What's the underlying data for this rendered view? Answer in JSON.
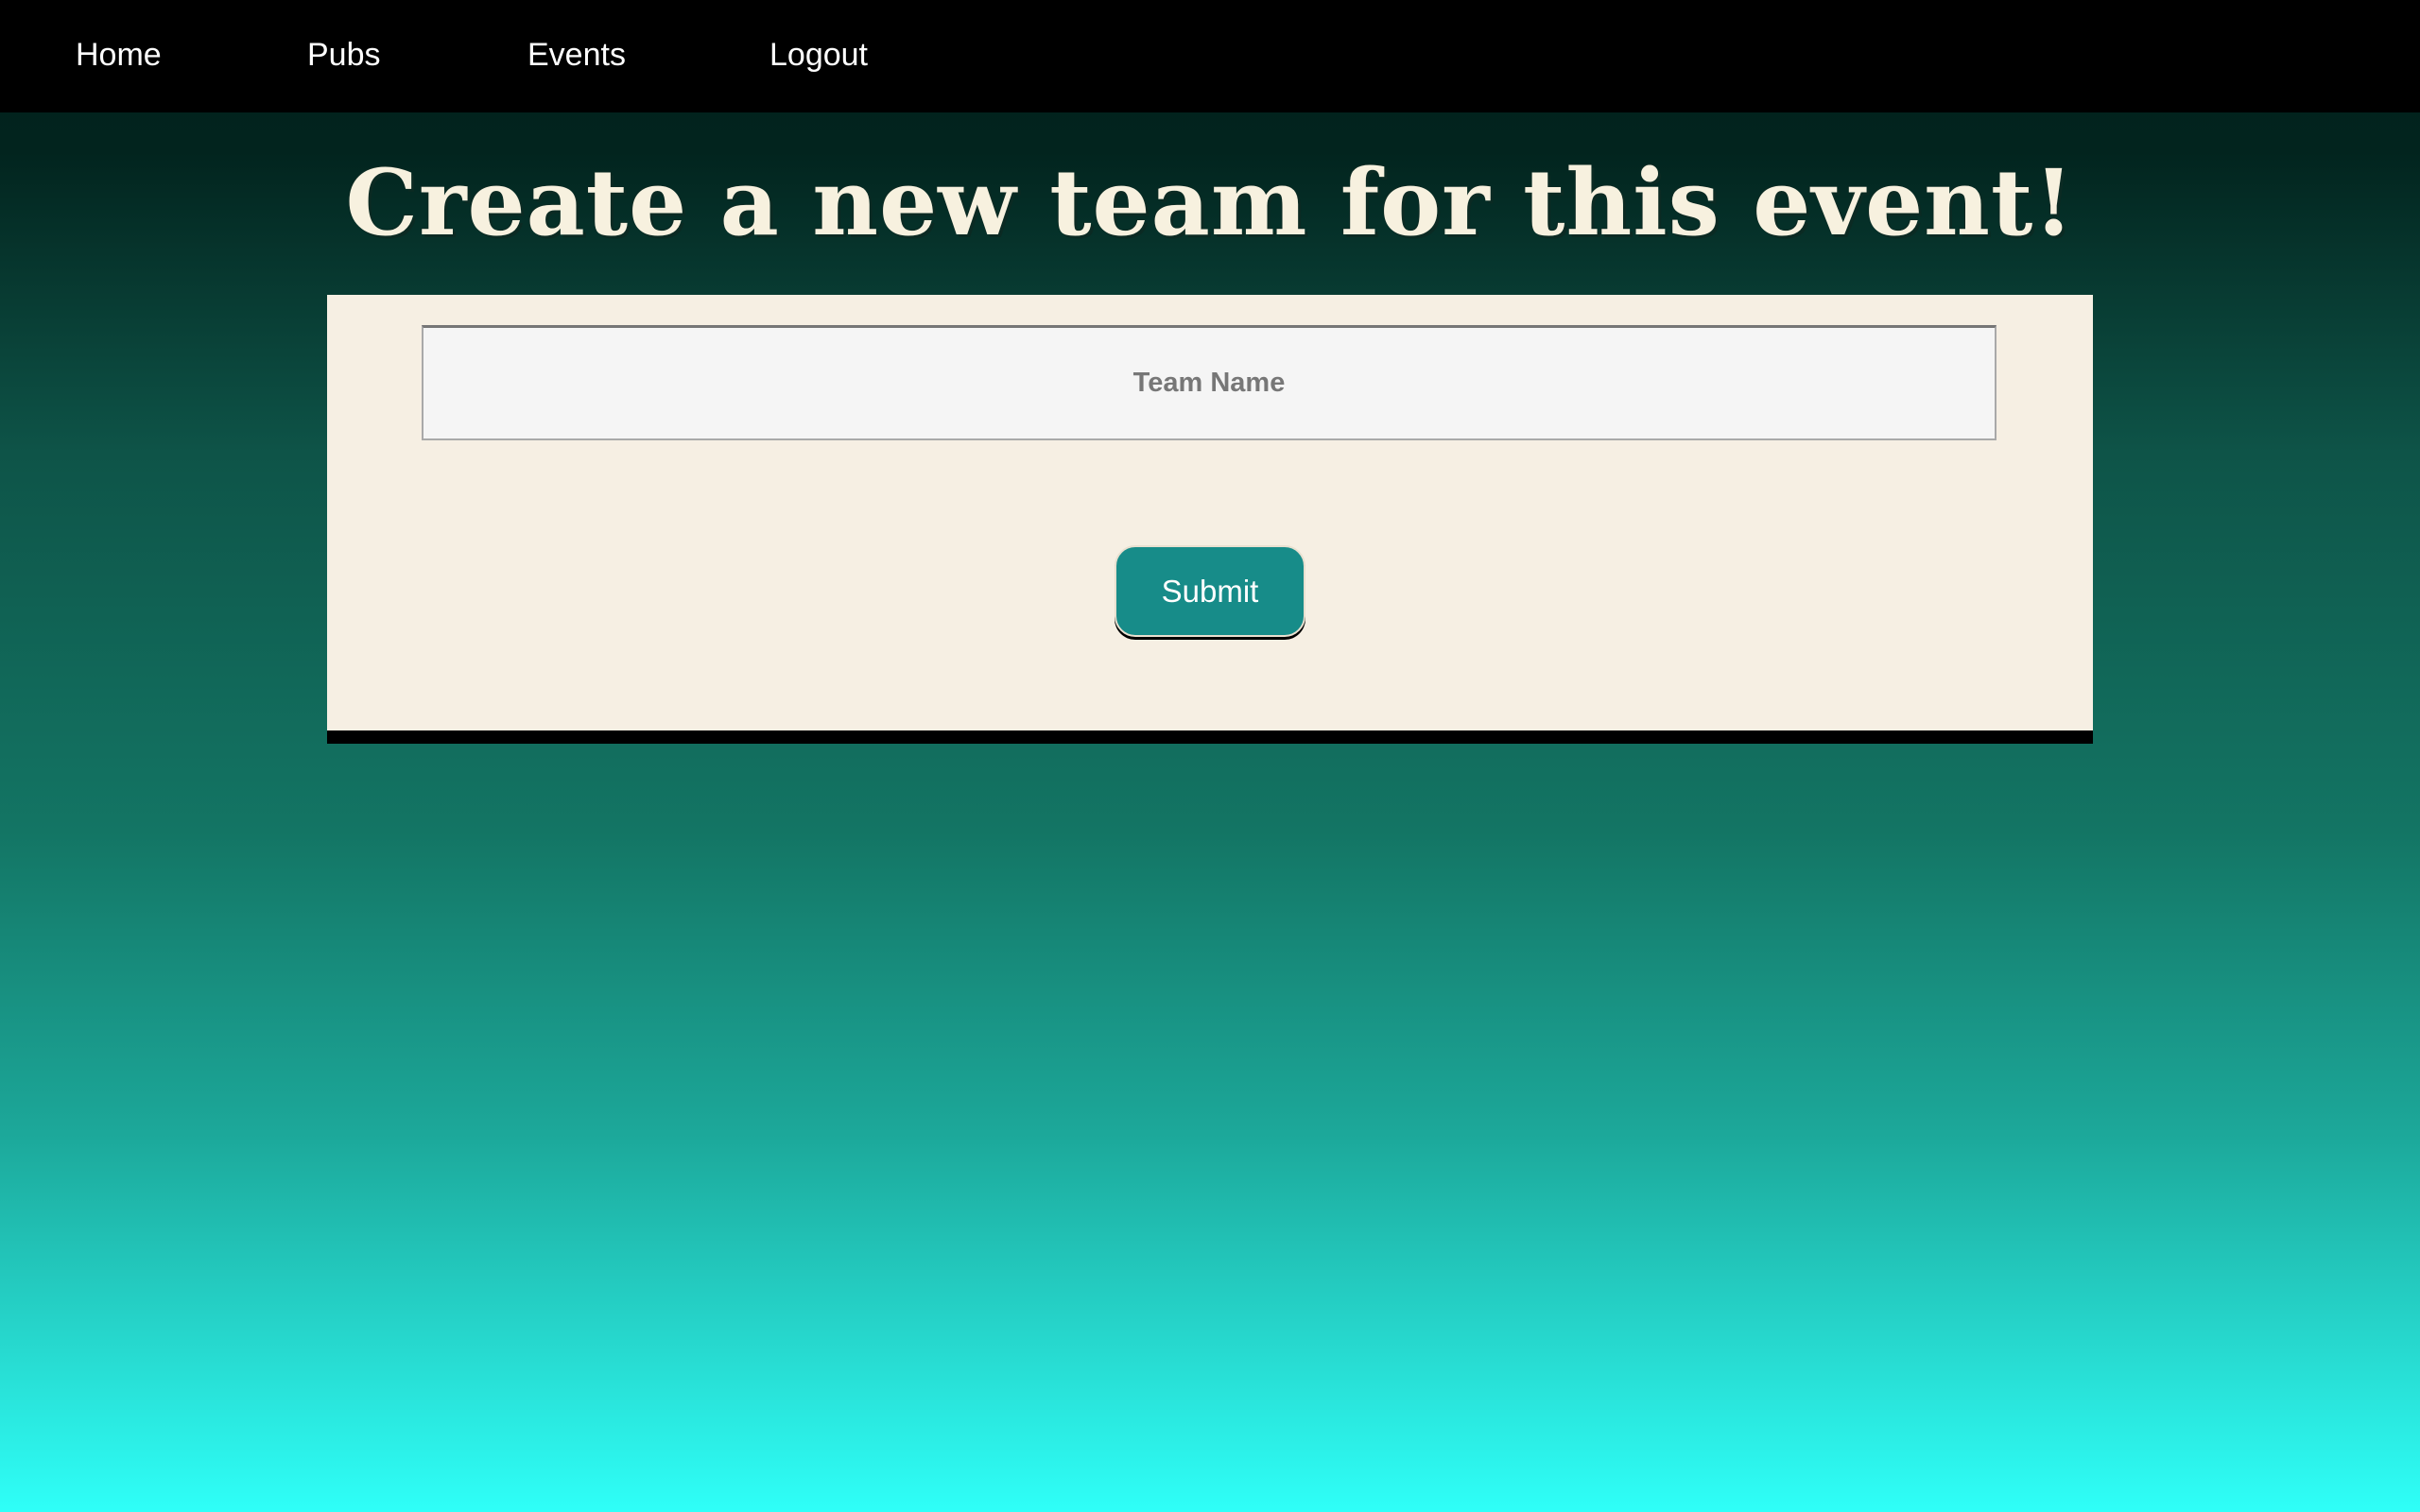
{
  "nav": {
    "items": [
      {
        "label": "Home"
      },
      {
        "label": "Pubs"
      },
      {
        "label": "Events"
      },
      {
        "label": "Logout"
      }
    ]
  },
  "main": {
    "title": "Create a new team for this event!",
    "form": {
      "team_name": {
        "value": "",
        "placeholder": "Team Name"
      },
      "submit_label": "Submit"
    }
  },
  "colors": {
    "navbar": "#000000",
    "title_text": "#f7f1df",
    "card_background": "#f6efe3",
    "submit_button": "#178c89",
    "gradient_top": "#00201b",
    "gradient_bottom": "#2ffff8"
  }
}
